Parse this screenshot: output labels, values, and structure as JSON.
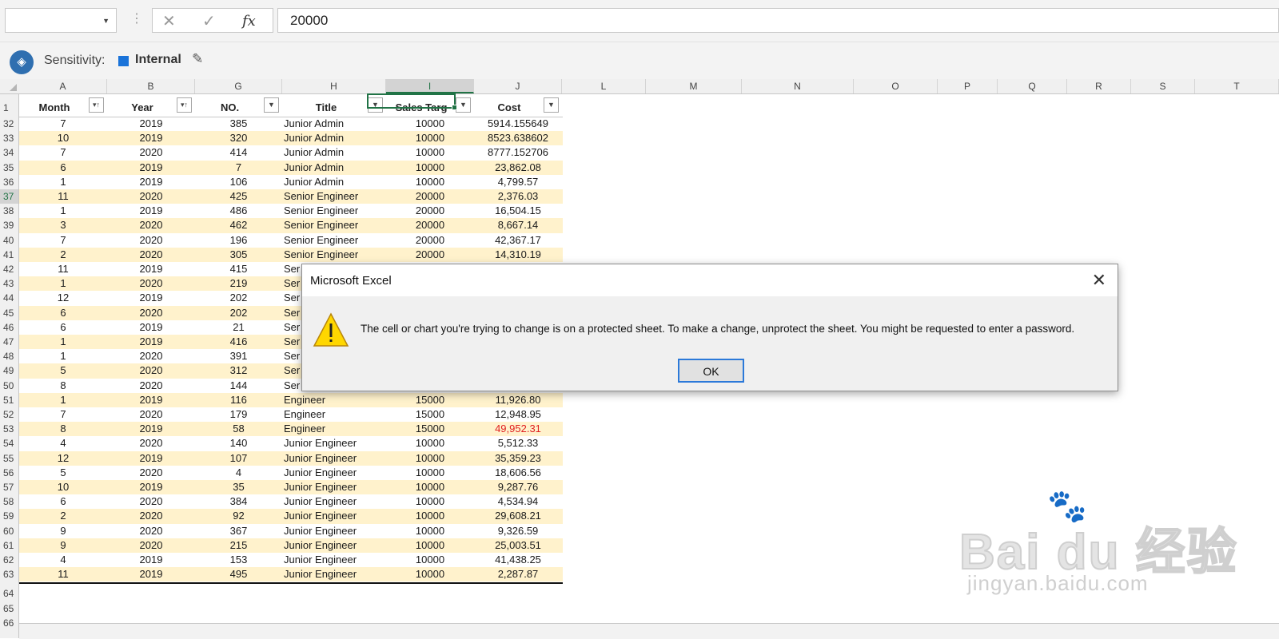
{
  "formula_bar": {
    "name_box": "",
    "cancel_icon": "✕",
    "enter_icon": "✓",
    "fx_label": "fx",
    "value": "20000"
  },
  "sensitivity": {
    "label": "Sensitivity:",
    "value": "Internal",
    "accent": "#1a73d9"
  },
  "columns": [
    "A",
    "B",
    "G",
    "H",
    "I",
    "J",
    "L",
    "M",
    "N",
    "O",
    "P",
    "Q",
    "R",
    "S",
    "T"
  ],
  "selected_column": "I",
  "table": {
    "headers": [
      "Month",
      "Year",
      "NO.",
      "Title",
      "Sales Targ",
      "Cost"
    ],
    "rows": [
      {
        "row": "32",
        "month": "7",
        "year": "2019",
        "no": "385",
        "title": "Junior Admin",
        "target": "10000",
        "cost": "5914.155649"
      },
      {
        "row": "33",
        "month": "10",
        "year": "2019",
        "no": "320",
        "title": "Junior Admin",
        "target": "10000",
        "cost": "8523.638602"
      },
      {
        "row": "34",
        "month": "7",
        "year": "2020",
        "no": "414",
        "title": "Junior Admin",
        "target": "10000",
        "cost": "8777.152706"
      },
      {
        "row": "35",
        "month": "6",
        "year": "2019",
        "no": "7",
        "title": "Junior Admin",
        "target": "10000",
        "cost": "23,862.08"
      },
      {
        "row": "36",
        "month": "1",
        "year": "2019",
        "no": "106",
        "title": "Junior Admin",
        "target": "10000",
        "cost": "4,799.57"
      },
      {
        "row": "37",
        "month": "11",
        "year": "2020",
        "no": "425",
        "title": "Senior Engineer",
        "target": "20000",
        "cost": "2,376.03"
      },
      {
        "row": "38",
        "month": "1",
        "year": "2019",
        "no": "486",
        "title": "Senior Engineer",
        "target": "20000",
        "cost": "16,504.15"
      },
      {
        "row": "39",
        "month": "3",
        "year": "2020",
        "no": "462",
        "title": "Senior Engineer",
        "target": "20000",
        "cost": "8,667.14"
      },
      {
        "row": "40",
        "month": "7",
        "year": "2020",
        "no": "196",
        "title": "Senior Engineer",
        "target": "20000",
        "cost": "42,367.17"
      },
      {
        "row": "41",
        "month": "2",
        "year": "2020",
        "no": "305",
        "title": "Senior Engineer",
        "target": "20000",
        "cost": "14,310.19"
      },
      {
        "row": "42",
        "month": "11",
        "year": "2019",
        "no": "415",
        "title": "Ser",
        "target": "",
        "cost": ""
      },
      {
        "row": "43",
        "month": "1",
        "year": "2020",
        "no": "219",
        "title": "Ser",
        "target": "",
        "cost": ""
      },
      {
        "row": "44",
        "month": "12",
        "year": "2019",
        "no": "202",
        "title": "Ser",
        "target": "",
        "cost": ""
      },
      {
        "row": "45",
        "month": "6",
        "year": "2020",
        "no": "202",
        "title": "Ser",
        "target": "",
        "cost": ""
      },
      {
        "row": "46",
        "month": "6",
        "year": "2019",
        "no": "21",
        "title": "Ser",
        "target": "",
        "cost": ""
      },
      {
        "row": "47",
        "month": "1",
        "year": "2019",
        "no": "416",
        "title": "Ser",
        "target": "",
        "cost": ""
      },
      {
        "row": "48",
        "month": "1",
        "year": "2020",
        "no": "391",
        "title": "Ser",
        "target": "",
        "cost": ""
      },
      {
        "row": "49",
        "month": "5",
        "year": "2020",
        "no": "312",
        "title": "Ser",
        "target": "",
        "cost": ""
      },
      {
        "row": "50",
        "month": "8",
        "year": "2020",
        "no": "144",
        "title": "Ser",
        "target": "",
        "cost": ""
      },
      {
        "row": "51",
        "month": "1",
        "year": "2019",
        "no": "116",
        "title": "Engineer",
        "target": "15000",
        "cost": "11,926.80"
      },
      {
        "row": "52",
        "month": "7",
        "year": "2020",
        "no": "179",
        "title": "Engineer",
        "target": "15000",
        "cost": "12,948.95"
      },
      {
        "row": "53",
        "month": "8",
        "year": "2019",
        "no": "58",
        "title": "Engineer",
        "target": "15000",
        "cost": "49,952.31"
      },
      {
        "row": "54",
        "month": "4",
        "year": "2020",
        "no": "140",
        "title": "Junior Engineer",
        "target": "10000",
        "cost": "5,512.33"
      },
      {
        "row": "55",
        "month": "12",
        "year": "2019",
        "no": "107",
        "title": "Junior Engineer",
        "target": "10000",
        "cost": "35,359.23"
      },
      {
        "row": "56",
        "month": "5",
        "year": "2020",
        "no": "4",
        "title": "Junior Engineer",
        "target": "10000",
        "cost": "18,606.56"
      },
      {
        "row": "57",
        "month": "10",
        "year": "2019",
        "no": "35",
        "title": "Junior Engineer",
        "target": "10000",
        "cost": "9,287.76"
      },
      {
        "row": "58",
        "month": "6",
        "year": "2020",
        "no": "384",
        "title": "Junior Engineer",
        "target": "10000",
        "cost": "4,534.94"
      },
      {
        "row": "59",
        "month": "2",
        "year": "2020",
        "no": "92",
        "title": "Junior Engineer",
        "target": "10000",
        "cost": "29,608.21"
      },
      {
        "row": "60",
        "month": "9",
        "year": "2020",
        "no": "367",
        "title": "Junior Engineer",
        "target": "10000",
        "cost": "9,326.59"
      },
      {
        "row": "61",
        "month": "9",
        "year": "2020",
        "no": "215",
        "title": "Junior Engineer",
        "target": "10000",
        "cost": "25,003.51"
      },
      {
        "row": "62",
        "month": "4",
        "year": "2019",
        "no": "153",
        "title": "Junior Engineer",
        "target": "10000",
        "cost": "41,438.25"
      },
      {
        "row": "63",
        "month": "11",
        "year": "2019",
        "no": "495",
        "title": "Junior Engineer",
        "target": "10000",
        "cost": "2,287.87"
      }
    ],
    "highlight_color": "#e02020"
  },
  "trailing_rows": [
    "64",
    "65",
    "66"
  ],
  "header_row_number": "1",
  "dialog": {
    "title": "Microsoft Excel",
    "message": "The cell or chart you're trying to change is on a protected sheet. To make a change, unprotect the sheet. You might be requested to enter a password.",
    "ok_label": "OK",
    "icon": "warning-icon"
  },
  "watermark": {
    "logo": "Bai du 经验",
    "url": "jingyan.baidu.com"
  }
}
